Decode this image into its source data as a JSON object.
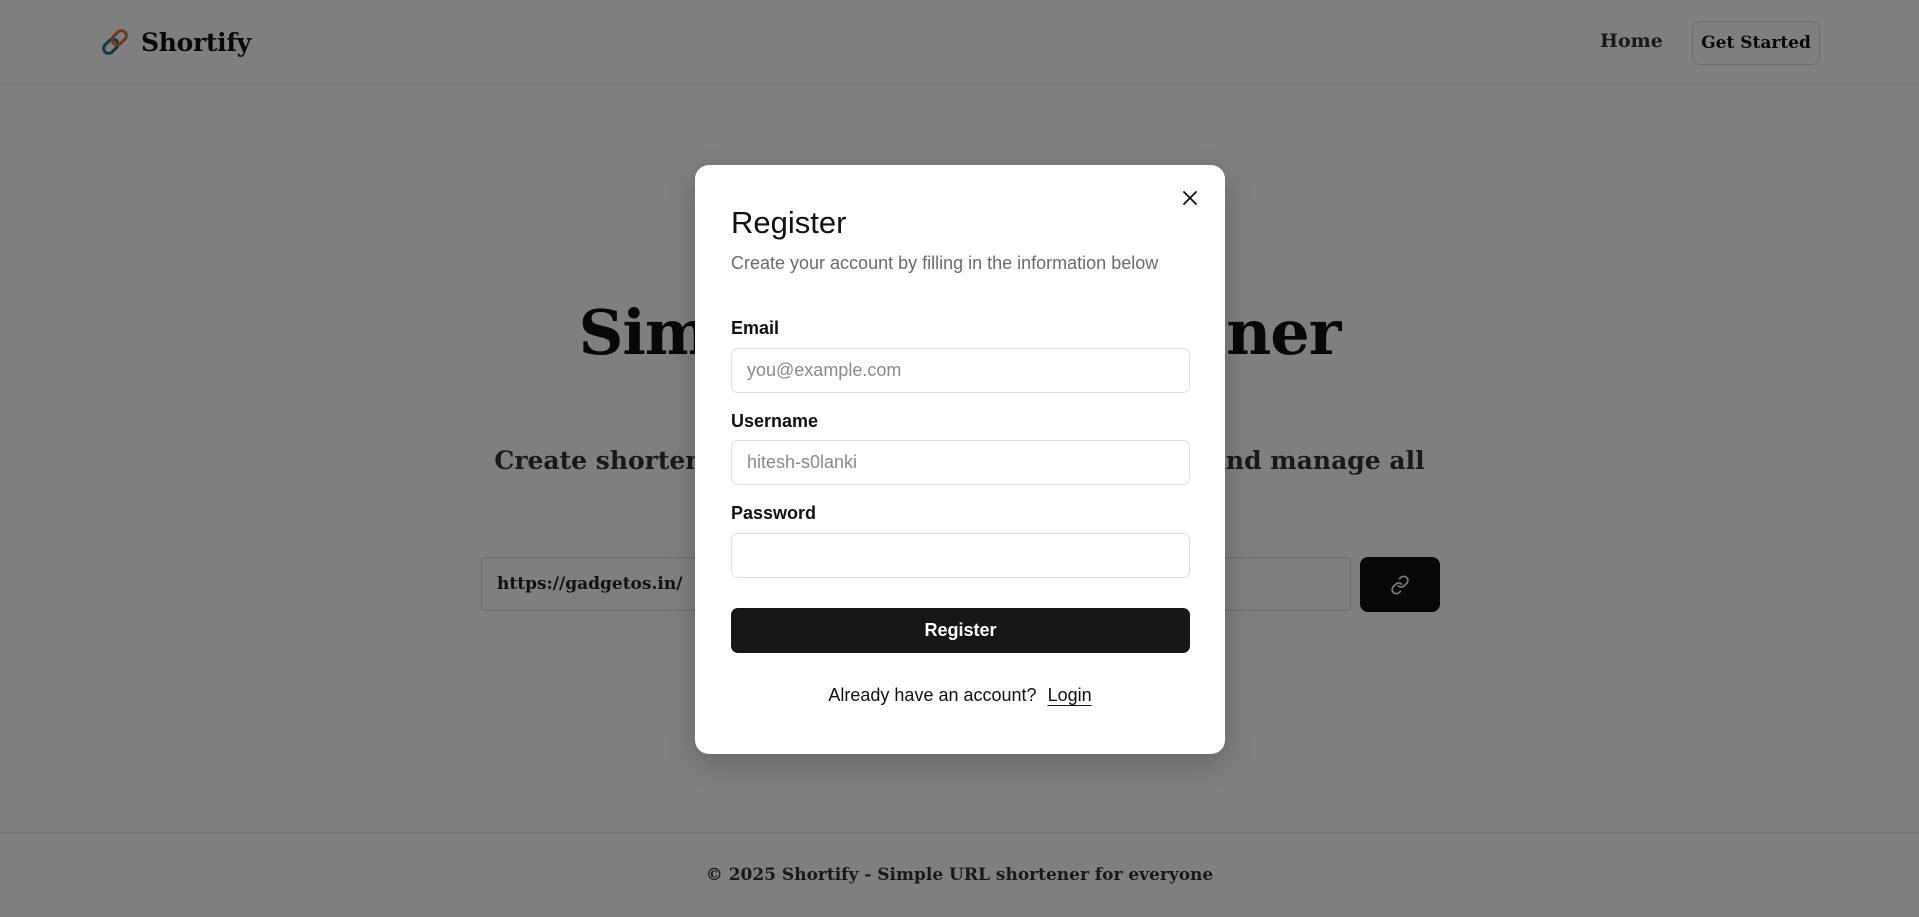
{
  "nav": {
    "brand": "Shortify",
    "home": "Home",
    "get_started": "Get Started"
  },
  "hero": {
    "title": "Simple URL Shortener",
    "subtitle": "Create shortened URLs, track clicks on your links, and manage all",
    "url_value": "https://gadgetos.in/"
  },
  "footer": {
    "text": "© 2025 Shortify - Simple URL shortener for everyone"
  },
  "modal": {
    "title": "Register",
    "subtitle": "Create your account by filling in the information below",
    "email_label": "Email",
    "email_placeholder": "you@example.com",
    "username_label": "Username",
    "username_placeholder": "hitesh-s0lanki",
    "password_label": "Password",
    "password_placeholder": "",
    "register_button": "Register",
    "login_prompt": "Already have an account?",
    "login_link": "Login"
  },
  "icons": {
    "brand": "link-icon",
    "shorten": "link-icon",
    "close": "close-icon"
  },
  "colors": {
    "primary_button": "#171717",
    "overlay": "rgba(0,0,0,0.5)"
  }
}
